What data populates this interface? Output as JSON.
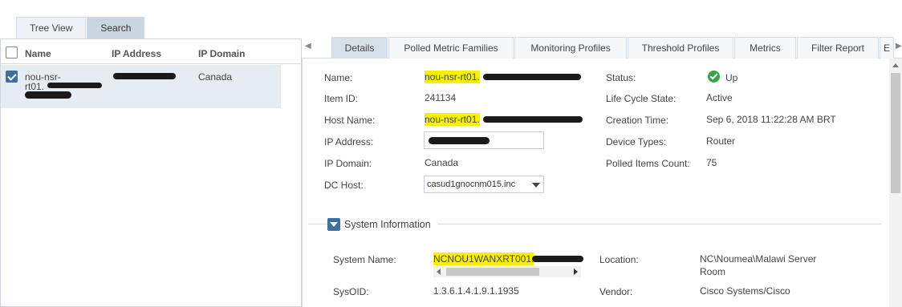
{
  "left_tabs": [
    "Tree View",
    "Search"
  ],
  "left_table": {
    "columns": [
      "Name",
      "IP Address",
      "IP Domain"
    ],
    "row": {
      "name_line1": "nou-nsr-",
      "name_line2": "rt01.",
      "ip_domain": "Canada"
    }
  },
  "detail_tabs": [
    "Details",
    "Polled Metric Families",
    "Monitoring Profiles",
    "Threshold Profiles",
    "Metrics",
    "Filter Report",
    "E"
  ],
  "details": {
    "name_label": "Name:",
    "name_value": "nou-nsr-rt01.",
    "item_id_label": "Item ID:",
    "item_id_value": "241134",
    "host_name_label": "Host Name:",
    "host_name_value": "nou-nsr-rt01.",
    "ip_address_label": "IP Address:",
    "ip_domain_label": "IP Domain:",
    "ip_domain_value": "Canada",
    "dc_host_label": "DC Host:",
    "dc_host_value": "casud1gnocnm015.inc",
    "status_label": "Status:",
    "status_value": "Up",
    "lifecycle_label": "Life Cycle State:",
    "lifecycle_value": "Active",
    "creation_label": "Creation Time:",
    "creation_value": "Sep 6, 2018 11:22:28 AM BRT",
    "device_types_label": "Device Types:",
    "device_types_value": "Router",
    "polled_label": "Polled Items Count:",
    "polled_value": "75"
  },
  "system_info": {
    "title": "System Information",
    "system_name_label": "System Name:",
    "system_name_value": "NCNOU1WANXRT001.",
    "location_label": "Location:",
    "location_line1": "NC\\Noumea\\Malawi Server",
    "location_line2": "Room",
    "sysoid_label": "SysOID:",
    "sysoid_value": "1.3.6.1.4.1.9.1.1935",
    "vendor_label": "Vendor:",
    "vendor_value": "Cisco Systems/Cisco"
  },
  "colors": {
    "highlight": "#f7f000",
    "status_up": "#36a447",
    "accent": "#3f6ea1"
  },
  "icons": {
    "status": "check-circle-icon",
    "section": "collapse-toggle-icon",
    "scroll_left": "chevron-left-icon",
    "scroll_right": "chevron-right-icon"
  }
}
